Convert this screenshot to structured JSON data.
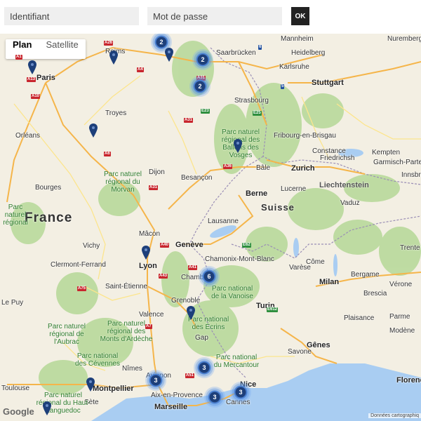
{
  "login": {
    "placeholder": "Identifiant",
    "password_placeholder": "Mot de passe",
    "ok_label": "OK"
  },
  "map": {
    "type_controls": [
      {
        "label": "Plan",
        "active": true
      },
      {
        "label": "Satellite",
        "active": false
      }
    ],
    "cities": [
      "Paris",
      "Reims",
      "Troyes",
      "Orléans",
      "Bourges",
      "Dijon",
      "Besançon",
      "Mâcon",
      "Vichy",
      "Lyon",
      "Clermont-Ferrand",
      "Saint-Étienne",
      "Valence",
      "Chambéry",
      "Grenoble",
      "Gap",
      "Nîmes",
      "Montpellier",
      "Avignon",
      "Aix-en-Provence",
      "Marseille",
      "Nice",
      "Cannes",
      "Sète",
      "Strasbourg",
      "Karlsruhe",
      "Heidelberg",
      "Mannheim",
      "Nuremberg",
      "Stuttgart",
      "Saarbrücken",
      "Fribourg-en-Brisgau",
      "Bâle",
      "Zurich",
      "Constance",
      "Berne",
      "Lucerne",
      "Lausanne",
      "Genève",
      "Chamonix-Mont-Blanc",
      "Turin",
      "Milan",
      "Bergame",
      "Brescia",
      "Vérone",
      "Varèse",
      "Côme",
      "Gênes",
      "Parme",
      "Modène",
      "Plaisance",
      "Savone",
      "Trente",
      "Kempten",
      "Garmisch-Partenkirchen",
      "Innsbruck",
      "Vaduz",
      "Friedrichshafen",
      "Florence",
      "Toulouse",
      "Le Puy",
      "Friedrichsh"
    ],
    "parks": [
      "Parc naturel régional du Morvan",
      "Parc naturel régional des Ballons des Vosges",
      "Parc national de la Vanoise",
      "Parc national des Écrins",
      "Parc national du Mercantour",
      "Parc naturel régional des Monts d'Ardèche",
      "Parc national des Cévennes",
      "Parc naturel régional de l'Aubrac",
      "Parc naturel régional du Haut-Languedoc",
      "Parc naturel régional"
    ],
    "countries": [
      "France",
      "Suisse",
      "Liechtenstein"
    ],
    "clusters": [
      "2",
      "2",
      "2",
      "3",
      "6",
      "3",
      "3",
      "3",
      "3"
    ],
    "google_text": "Google",
    "copyright": "Données cartographiq"
  },
  "colors": {
    "land": "#f3efe3",
    "forest": "#b9d99b",
    "water": "#a9cdf2",
    "motorway": "#f5b54a",
    "road": "#fce58d",
    "border": "#9b8fb6",
    "marker": "#1d3f7a"
  },
  "icons": [
    "map-pin-icon",
    "cluster-icon",
    "google-logo"
  ]
}
